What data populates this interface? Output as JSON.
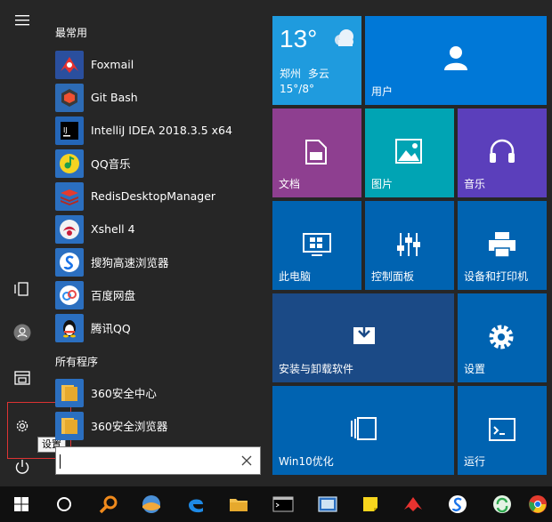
{
  "sections": {
    "most_used": "最常用",
    "all_programs": "所有程序"
  },
  "most_used_apps": [
    {
      "label": "Foxmail",
      "icon": "foxmail-icon",
      "color": "#2a4f9e"
    },
    {
      "label": "Git Bash",
      "icon": "git-bash-icon",
      "color": "#2d6bb5"
    },
    {
      "label": "IntelliJ IDEA 2018.3.5 x64",
      "icon": "intellij-icon",
      "color": "#2466b8"
    },
    {
      "label": "QQ音乐",
      "icon": "qq-music-icon",
      "color": "#2b6fc0"
    },
    {
      "label": "RedisDesktopManager",
      "icon": "redis-icon",
      "color": "#2b6fc0"
    },
    {
      "label": "Xshell 4",
      "icon": "xshell-icon",
      "color": "#2b6fc0"
    },
    {
      "label": "搜狗高速浏览器",
      "icon": "sogou-browser-icon",
      "color": "#2b6fc0"
    },
    {
      "label": "百度网盘",
      "icon": "baidu-netdisk-icon",
      "color": "#2b6fc0"
    },
    {
      "label": "腾讯QQ",
      "icon": "tencent-qq-icon",
      "color": "#2b6fc0"
    }
  ],
  "all_programs_apps": [
    {
      "label": "360安全中心",
      "icon": "folder-icon",
      "color": "#2b6fc0"
    },
    {
      "label": "360安全浏览器",
      "icon": "folder-icon",
      "color": "#2b6fc0"
    }
  ],
  "search": {
    "value": "",
    "placeholder": ""
  },
  "tooltip": "设置",
  "tiles": {
    "weather": {
      "temp": "13°",
      "city": "郑州",
      "condition": "多云",
      "range": "15°/8°",
      "color": "#1f9bde"
    },
    "user": {
      "label": "用户",
      "color": "#0078d7"
    },
    "docs": {
      "label": "文档",
      "color": "#8e3f90"
    },
    "pics": {
      "label": "图片",
      "color": "#00a4b4"
    },
    "music": {
      "label": "音乐",
      "color": "#5b3fbb"
    },
    "pc": {
      "label": "此电脑",
      "color": "#0063b1"
    },
    "control": {
      "label": "控制面板",
      "color": "#0063b1"
    },
    "devices": {
      "label": "设备和打印机",
      "color": "#0063b1"
    },
    "install": {
      "label": "安装与卸载软件",
      "color": "#1b4a86"
    },
    "settings": {
      "label": "设置",
      "color": "#0063b1"
    },
    "win10": {
      "label": "Win10优化",
      "color": "#0063b1"
    },
    "run": {
      "label": "运行",
      "color": "#0063b1"
    }
  }
}
